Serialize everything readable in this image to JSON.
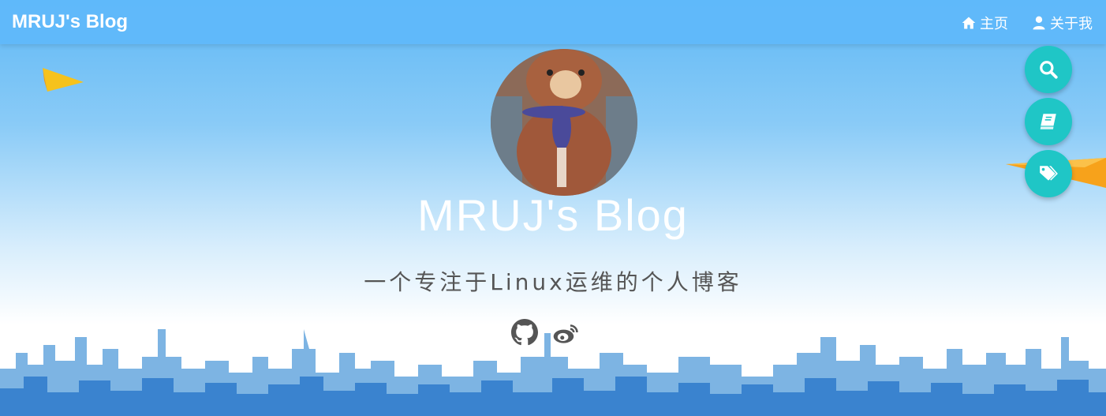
{
  "navbar": {
    "brand": "MRUJ's Blog",
    "links": [
      {
        "label": "主页",
        "icon": "home-icon"
      },
      {
        "label": "关于我",
        "icon": "user-icon"
      }
    ]
  },
  "hero": {
    "title": "MRUJ's Blog",
    "tagline": "一个专注于Linux运维的个人博客",
    "social": [
      {
        "icon": "github-icon"
      },
      {
        "icon": "weibo-icon"
      }
    ]
  },
  "fabs": [
    {
      "icon": "search-icon"
    },
    {
      "icon": "book-icon"
    },
    {
      "icon": "tags-icon"
    }
  ],
  "colors": {
    "accent": "#1fc6c6",
    "navbar": "#5fb9fa",
    "text_dark": "#555555"
  }
}
